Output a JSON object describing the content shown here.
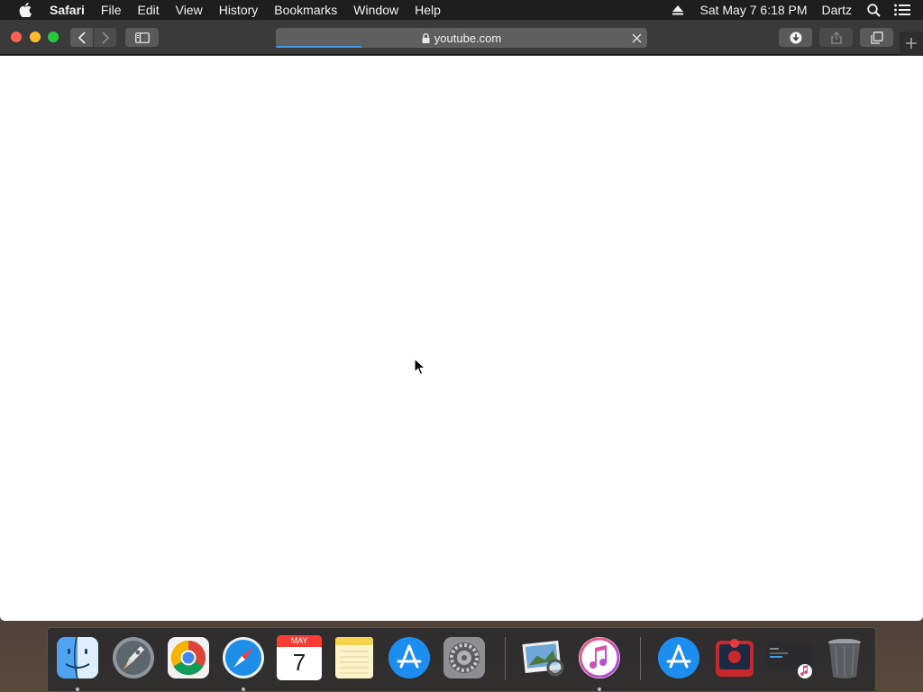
{
  "menubar": {
    "app_name": "Safari",
    "items": [
      "File",
      "Edit",
      "View",
      "History",
      "Bookmarks",
      "Window",
      "Help"
    ],
    "status": {
      "datetime": "Sat May 7  6:18 PM",
      "user": "Dartz"
    }
  },
  "toolbar": {
    "address": "youtube.com",
    "load_progress": 0.23
  },
  "dock": {
    "calendar_month": "MAY",
    "calendar_day": "7",
    "apps": [
      "finder",
      "launchpad",
      "chrome",
      "safari",
      "calendar",
      "notes",
      "app-store",
      "system-preferences",
      "preview",
      "itunes",
      "app-store-downloads",
      "photo-booth",
      "itunes-screen",
      "trash"
    ]
  },
  "colors": {
    "menubar_bg": "#1e1e1e",
    "toolbar_bg": "#3a3a3a",
    "progress": "#3d9be9",
    "close": "#fe5f57",
    "minimize": "#febc2e",
    "maximize": "#28c840"
  }
}
